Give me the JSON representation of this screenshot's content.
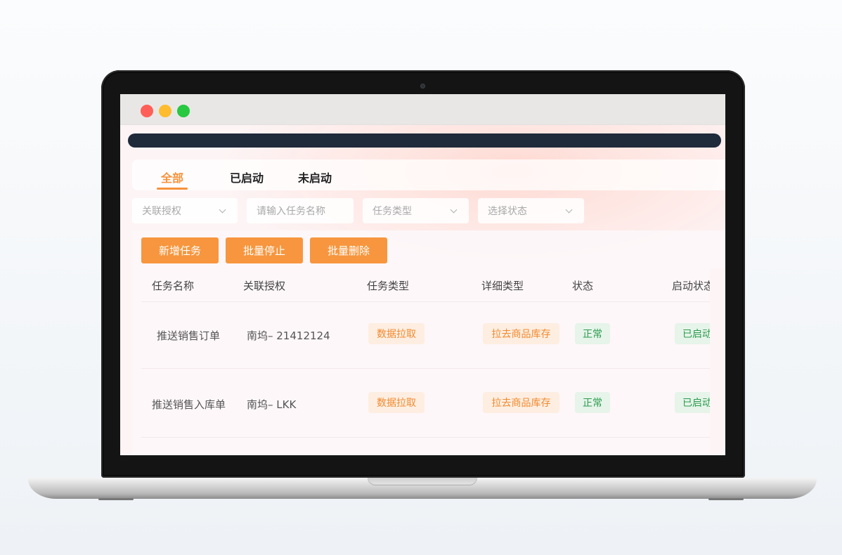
{
  "tabs": [
    {
      "label": "全部",
      "active": true
    },
    {
      "label": "已启动",
      "active": false
    },
    {
      "label": "未启动",
      "active": false
    }
  ],
  "filters": {
    "auth": "关联授权",
    "task_name_placeholder": "请输入任务名称",
    "task_type": "任务类型",
    "status": "选择状态"
  },
  "actions": {
    "add": "新增任务",
    "stop": "批量停止",
    "delete": "批量删除"
  },
  "table": {
    "headers": [
      "任务名称",
      "关联授权",
      "任务类型",
      "详细类型",
      "状态",
      "启动状态"
    ],
    "rows": [
      {
        "name": "推送销售订单",
        "auth": "南坞– 21412124",
        "type": "数据拉取",
        "detail": "拉去商品库存",
        "status": "正常",
        "run": "已启动"
      },
      {
        "name": "推送销售入库单",
        "auth": "南坞– LKK",
        "type": "数据拉取",
        "detail": "拉去商品库存",
        "status": "正常",
        "run": "已启动"
      }
    ]
  },
  "colors": {
    "accent": "#f7963e",
    "navbar": "#1f2a3b",
    "success": "#2c9b4d"
  }
}
